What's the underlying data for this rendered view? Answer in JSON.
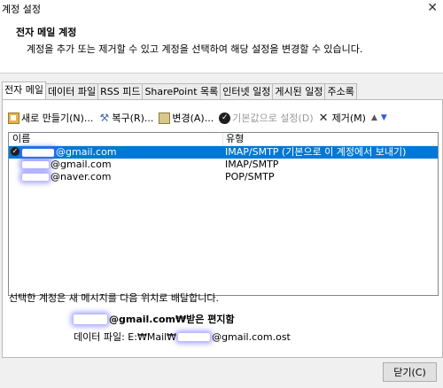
{
  "window": {
    "title": "계정 설정",
    "close_glyph": "✕"
  },
  "header": {
    "title": "전자 메일 계정",
    "description": "계정을 추가 또는 제거할 수 있고 계정을 선택하여 해당 설정을 변경할 수 있습니다."
  },
  "tabs": [
    {
      "label": "전자 메일",
      "active": true
    },
    {
      "label": "데이터 파일"
    },
    {
      "label": "RSS 피드"
    },
    {
      "label": "SharePoint 목록"
    },
    {
      "label": "인터넷 일정"
    },
    {
      "label": "게시된 일정"
    },
    {
      "label": "주소록"
    }
  ],
  "toolbar": {
    "new_label": "새로 만들기(N)...",
    "repair_label": "복구(R)...",
    "change_label": "변경(A)...",
    "default_label": "기본값으로 설정(D)",
    "remove_label": "제거(M)",
    "icons": [
      "new-account-icon",
      "repair-icon",
      "change-icon",
      "set-default-icon",
      "remove-icon",
      "move-up-icon",
      "move-down-icon"
    ]
  },
  "list": {
    "columns": [
      "이름",
      "유형"
    ],
    "rows": [
      {
        "name": "@gmail.com",
        "type": "IMAP/SMTP (기본으로 이 계정에서 보내기)",
        "selected": true,
        "default": true
      },
      {
        "name": "@gmail.com",
        "type": "IMAP/SMTP"
      },
      {
        "name": "@naver.com",
        "type": "POP/SMTP"
      }
    ]
  },
  "delivery": {
    "label": "선택한 계정은 새 메시지를 다음 위치로 배달합니다.",
    "account": "@gmail.com₩받은 편지함",
    "data_file_prefix": "데이터 파일: E:₩Mail₩",
    "data_file_suffix": "@gmail.com.ost"
  },
  "footer": {
    "close_label": "닫기(C)"
  },
  "colors": {
    "selection": "#0078d7",
    "redaction_glow": "#6464ff"
  }
}
